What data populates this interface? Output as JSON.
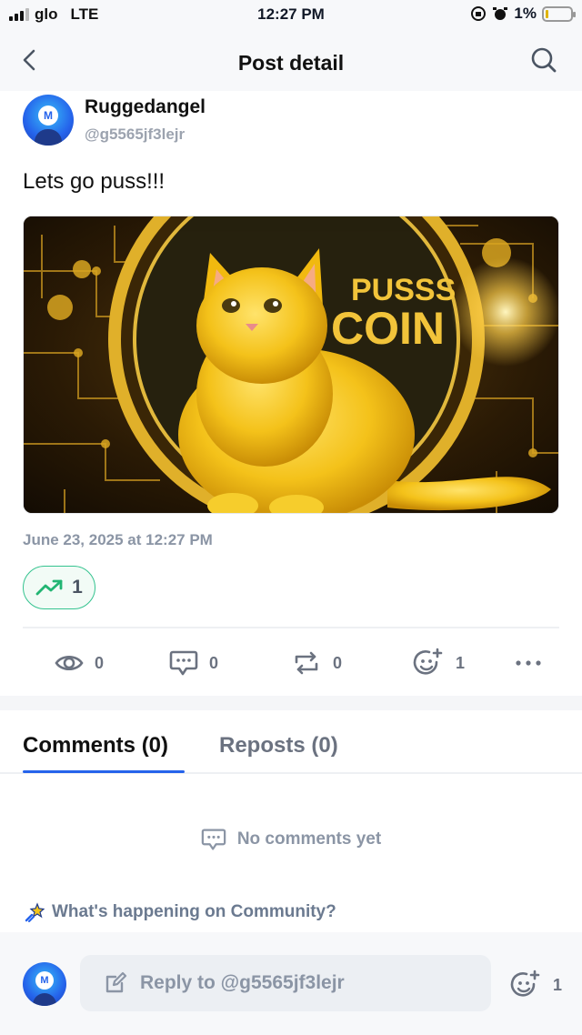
{
  "status_bar": {
    "carrier": "glo",
    "network": "LTE",
    "time": "12:27 PM",
    "battery": "1%"
  },
  "header": {
    "title": "Post detail",
    "back_icon": "chevron-left-icon",
    "search_icon": "search-icon"
  },
  "post": {
    "author_name": "Ruggedangel",
    "author_handle": "@g5565jf3lejr",
    "text": "Lets go puss!!!",
    "image_caption_text": "PUSSS COIN",
    "date": "June 23, 2025 at 12:27 PM",
    "trend_count": "1",
    "stats": {
      "views": "0",
      "comments": "0",
      "reposts": "0",
      "reactions": "1"
    }
  },
  "tabs": [
    {
      "label": "Comments (0)",
      "active": true
    },
    {
      "label": "Reposts (0)",
      "active": false
    }
  ],
  "comments": {
    "empty_text": "No comments yet"
  },
  "community": {
    "prompt": "What's happening on Community?"
  },
  "reply": {
    "placeholder": "Reply to @g5565jf3lejr",
    "reaction_count": "1"
  },
  "colors": {
    "accent": "#2563eb",
    "trend_green": "#34c38f",
    "muted_text": "#8b95a5",
    "icon_gray": "#6b7280"
  }
}
